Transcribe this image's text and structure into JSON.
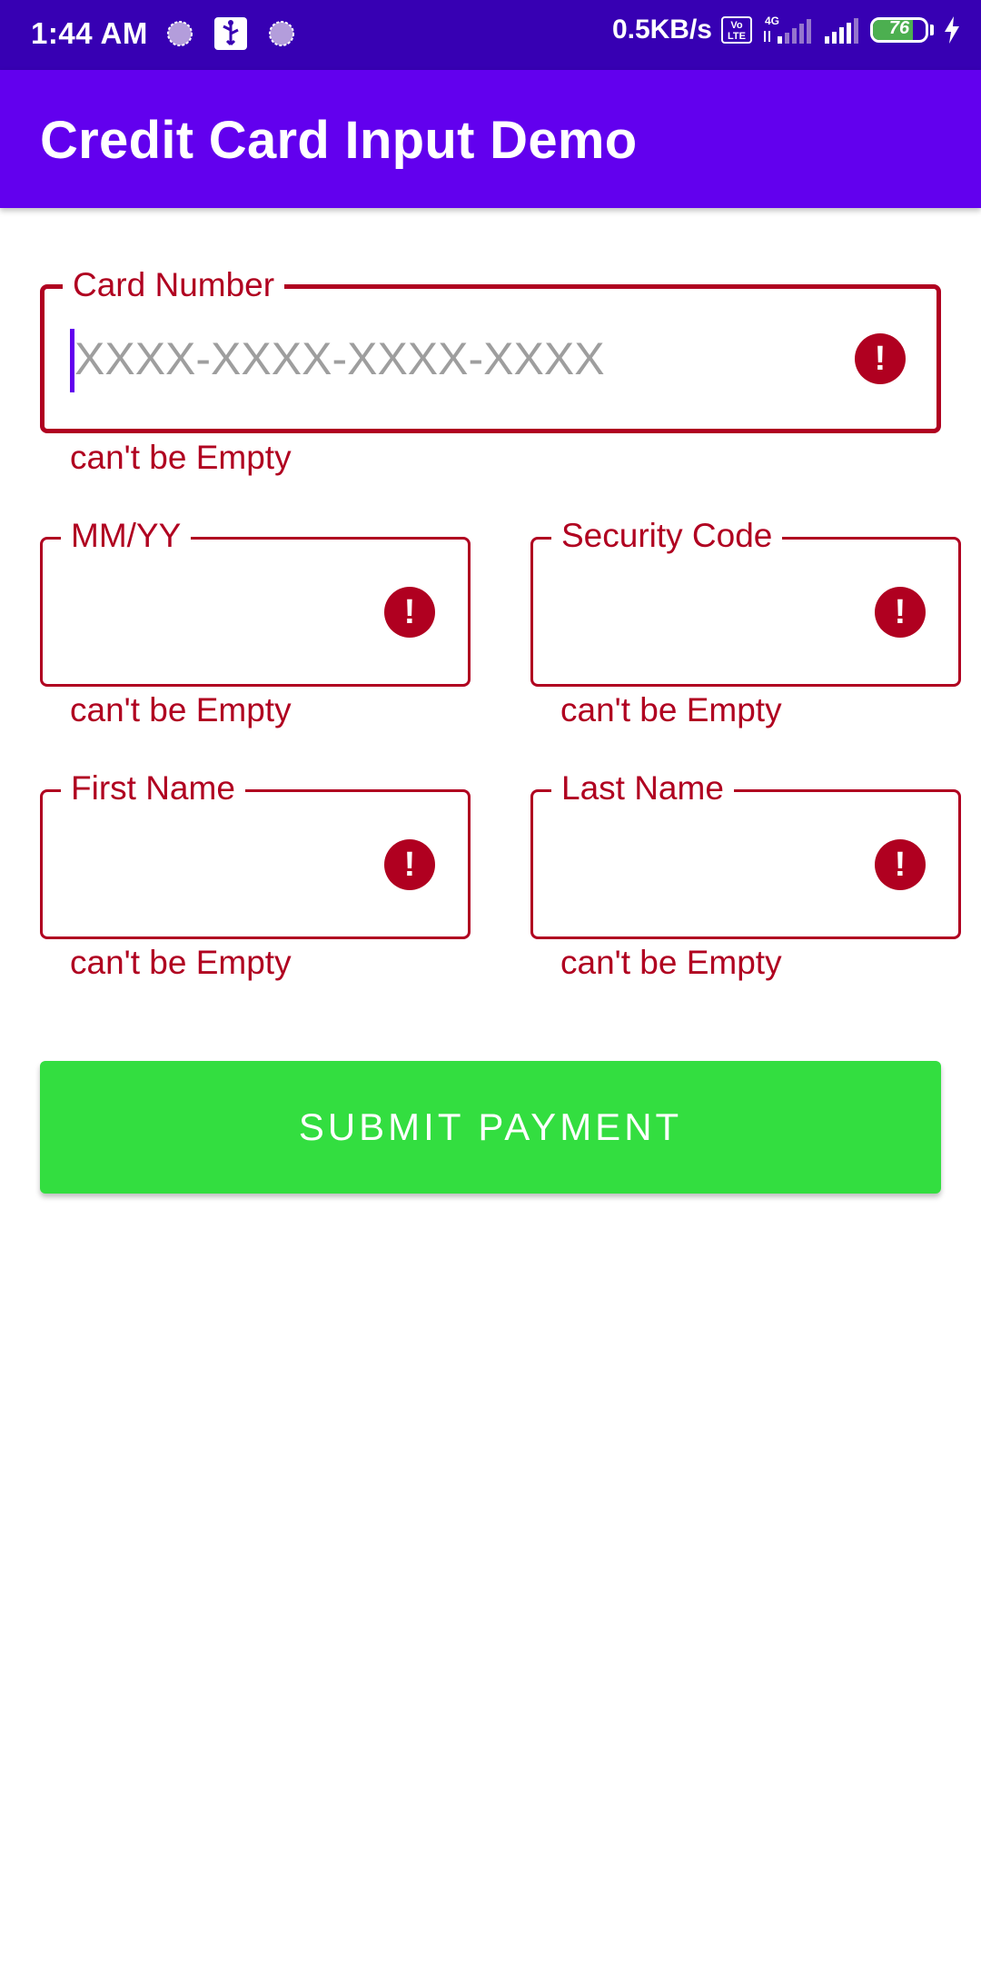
{
  "status_bar": {
    "time": "1:44 AM",
    "net_speed": "0.5KB/s",
    "volte_label": "Vo LTE",
    "network_label": "4G",
    "battery_level": "76",
    "left_icons": [
      "notification-dot-icon",
      "usb-icon",
      "notification-dot-icon"
    ],
    "right_icons": [
      "volte-icon",
      "signal-4g-icon",
      "signal-icon",
      "battery-icon",
      "charging-bolt-icon"
    ]
  },
  "app_bar": {
    "title": "Credit Card Input Demo"
  },
  "form": {
    "card_number": {
      "label": "Card Number",
      "placeholder": "XXXX-XXXX-XXXX-XXXX",
      "error": "can't be Empty"
    },
    "expiry": {
      "label": "MM/YY",
      "error": "can't be Empty"
    },
    "security_code": {
      "label": "Security Code",
      "error": "can't be Empty"
    },
    "first_name": {
      "label": "First Name",
      "error": "can't be Empty"
    },
    "last_name": {
      "label": "Last Name",
      "error": "can't be Empty"
    },
    "error_icon_glyph": "!"
  },
  "submit": {
    "label": "SUBMIT PAYMENT"
  },
  "colors": {
    "status_bar": "#3700b3",
    "app_bar": "#6200ee",
    "error": "#b00020",
    "submit_button": "#33de40",
    "cursor": "#6200ee"
  }
}
